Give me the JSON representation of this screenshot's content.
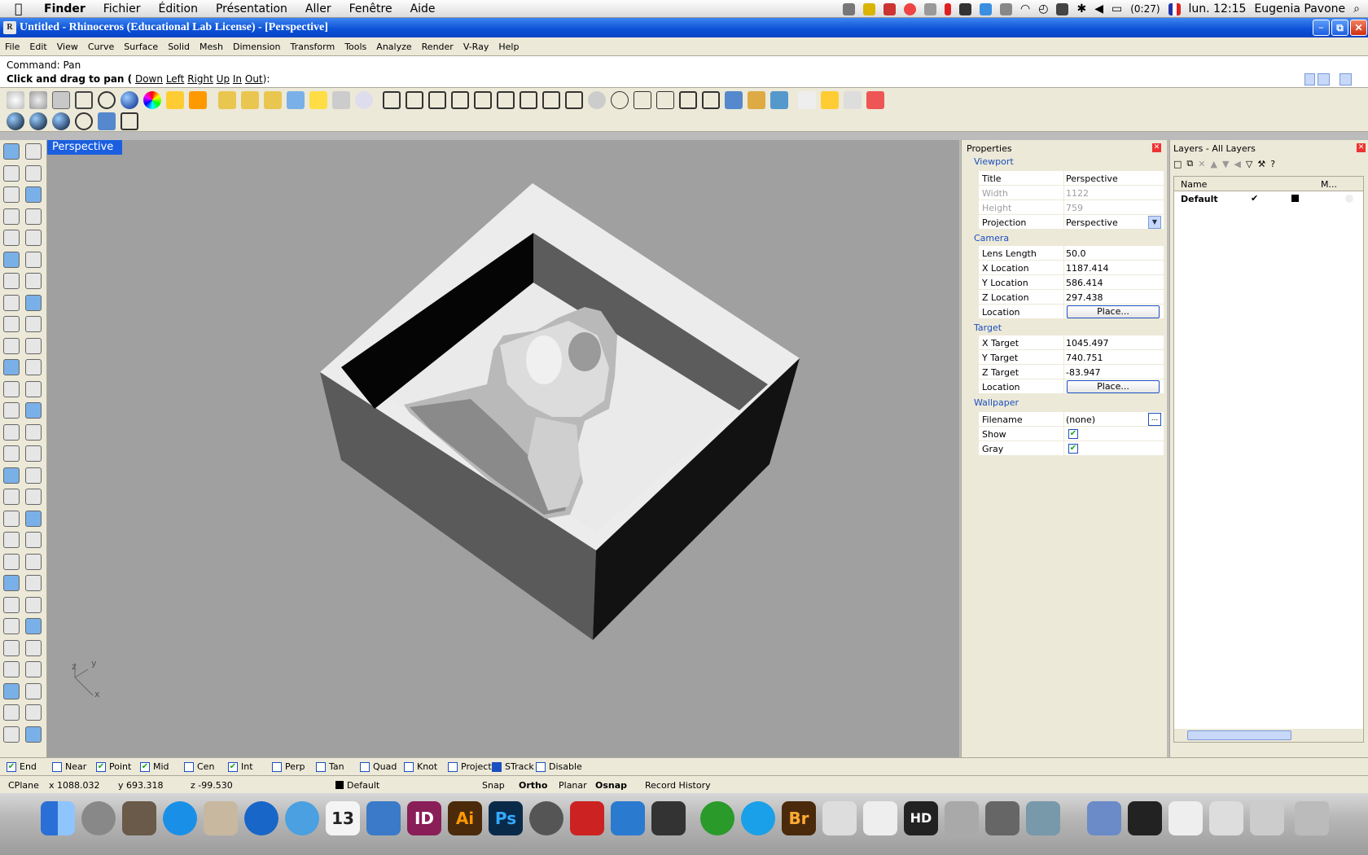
{
  "mac_menu": {
    "apple": "",
    "app": "Finder",
    "items": [
      "Fichier",
      "Édition",
      "Présentation",
      "Aller",
      "Fenêtre",
      "Aide"
    ],
    "battery": "(0:27)",
    "clock": "lun. 12:15",
    "user": "Eugenia Pavone"
  },
  "window": {
    "title": "Untitled - Rhinoceros (Educational Lab License) - [Perspective]"
  },
  "rhino_menu": [
    "File",
    "Edit",
    "View",
    "Curve",
    "Surface",
    "Solid",
    "Mesh",
    "Dimension",
    "Transform",
    "Tools",
    "Analyze",
    "Render",
    "V-Ray",
    "Help"
  ],
  "command": {
    "line1": "Command: Pan",
    "prompt": "Click and drag to pan (",
    "options": [
      "Down",
      "Left",
      "Right",
      "Up",
      "In",
      "Out"
    ],
    "suffix": "):"
  },
  "viewport": {
    "tab": "Perspective",
    "axis_y": "y",
    "axis_z": "z",
    "axis_x": "x"
  },
  "properties": {
    "header": "Properties",
    "sections": {
      "viewport": "Viewport",
      "camera": "Camera",
      "target": "Target",
      "wallpaper": "Wallpaper"
    },
    "title_k": "Title",
    "title_v": "Perspective",
    "width_k": "Width",
    "width_v": "1122",
    "height_k": "Height",
    "height_v": "759",
    "projection_k": "Projection",
    "projection_v": "Perspective",
    "lens_k": "Lens Length",
    "lens_v": "50.0",
    "xloc_k": "X Location",
    "xloc_v": "1187.414",
    "yloc_k": "Y Location",
    "yloc_v": "586.414",
    "zloc_k": "Z Location",
    "zloc_v": "297.438",
    "loc_k": "Location",
    "place": "Place...",
    "xt_k": "X Target",
    "xt_v": "1045.497",
    "yt_k": "Y Target",
    "yt_v": "740.751",
    "zt_k": "Z Target",
    "zt_v": "-83.947",
    "tloc_k": "Location",
    "file_k": "Filename",
    "file_v": "(none)",
    "browse": "...",
    "show_k": "Show",
    "gray_k": "Gray"
  },
  "layers": {
    "header": "Layers - All Layers",
    "col_name": "Name",
    "col_m": "M...",
    "rows": [
      {
        "name": "Default"
      }
    ]
  },
  "osnap": [
    {
      "label": "End",
      "checked": true
    },
    {
      "label": "Near",
      "checked": false
    },
    {
      "label": "Point",
      "checked": true
    },
    {
      "label": "Mid",
      "checked": true
    },
    {
      "label": "Cen",
      "checked": false
    },
    {
      "label": "Int",
      "checked": true
    },
    {
      "label": "Perp",
      "checked": false
    },
    {
      "label": "Tan",
      "checked": false
    },
    {
      "label": "Quad",
      "checked": false
    },
    {
      "label": "Knot",
      "checked": false
    },
    {
      "label": "Project",
      "checked": false
    },
    {
      "label": "STrack",
      "checked": true
    },
    {
      "label": "Disable",
      "checked": false
    }
  ],
  "status": {
    "cplane": "CPlane",
    "x": "x 1088.032",
    "y": "y 693.318",
    "z": "z -99.530",
    "layer": "Default",
    "snap": "Snap",
    "ortho": "Ortho",
    "planar": "Planar",
    "osnap": "Osnap",
    "record": "Record History"
  },
  "dock": {
    "calendar_day": "13",
    "labels": {
      "id": "ID",
      "ai": "Ai",
      "ps": "Ps",
      "br": "Br",
      "hd": "HD"
    }
  }
}
